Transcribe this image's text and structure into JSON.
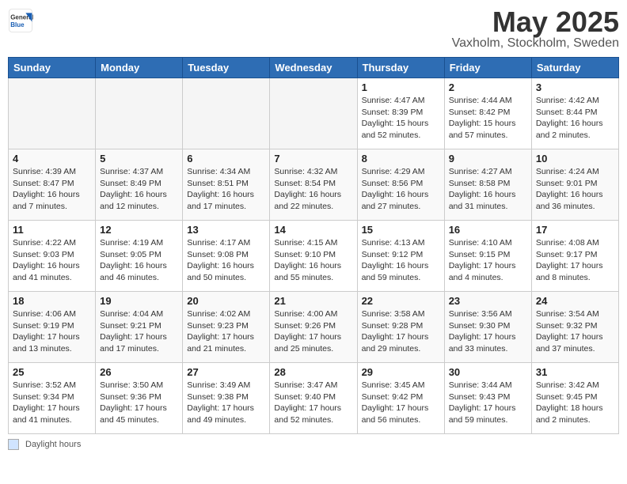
{
  "header": {
    "logo_general": "General",
    "logo_blue": "Blue",
    "month_title": "May 2025",
    "location": "Vaxholm, Stockholm, Sweden"
  },
  "calendar": {
    "days_of_week": [
      "Sunday",
      "Monday",
      "Tuesday",
      "Wednesday",
      "Thursday",
      "Friday",
      "Saturday"
    ],
    "weeks": [
      [
        {
          "day": "",
          "info": ""
        },
        {
          "day": "",
          "info": ""
        },
        {
          "day": "",
          "info": ""
        },
        {
          "day": "",
          "info": ""
        },
        {
          "day": "1",
          "info": "Sunrise: 4:47 AM\nSunset: 8:39 PM\nDaylight: 15 hours\nand 52 minutes."
        },
        {
          "day": "2",
          "info": "Sunrise: 4:44 AM\nSunset: 8:42 PM\nDaylight: 15 hours\nand 57 minutes."
        },
        {
          "day": "3",
          "info": "Sunrise: 4:42 AM\nSunset: 8:44 PM\nDaylight: 16 hours\nand 2 minutes."
        }
      ],
      [
        {
          "day": "4",
          "info": "Sunrise: 4:39 AM\nSunset: 8:47 PM\nDaylight: 16 hours\nand 7 minutes."
        },
        {
          "day": "5",
          "info": "Sunrise: 4:37 AM\nSunset: 8:49 PM\nDaylight: 16 hours\nand 12 minutes."
        },
        {
          "day": "6",
          "info": "Sunrise: 4:34 AM\nSunset: 8:51 PM\nDaylight: 16 hours\nand 17 minutes."
        },
        {
          "day": "7",
          "info": "Sunrise: 4:32 AM\nSunset: 8:54 PM\nDaylight: 16 hours\nand 22 minutes."
        },
        {
          "day": "8",
          "info": "Sunrise: 4:29 AM\nSunset: 8:56 PM\nDaylight: 16 hours\nand 27 minutes."
        },
        {
          "day": "9",
          "info": "Sunrise: 4:27 AM\nSunset: 8:58 PM\nDaylight: 16 hours\nand 31 minutes."
        },
        {
          "day": "10",
          "info": "Sunrise: 4:24 AM\nSunset: 9:01 PM\nDaylight: 16 hours\nand 36 minutes."
        }
      ],
      [
        {
          "day": "11",
          "info": "Sunrise: 4:22 AM\nSunset: 9:03 PM\nDaylight: 16 hours\nand 41 minutes."
        },
        {
          "day": "12",
          "info": "Sunrise: 4:19 AM\nSunset: 9:05 PM\nDaylight: 16 hours\nand 46 minutes."
        },
        {
          "day": "13",
          "info": "Sunrise: 4:17 AM\nSunset: 9:08 PM\nDaylight: 16 hours\nand 50 minutes."
        },
        {
          "day": "14",
          "info": "Sunrise: 4:15 AM\nSunset: 9:10 PM\nDaylight: 16 hours\nand 55 minutes."
        },
        {
          "day": "15",
          "info": "Sunrise: 4:13 AM\nSunset: 9:12 PM\nDaylight: 16 hours\nand 59 minutes."
        },
        {
          "day": "16",
          "info": "Sunrise: 4:10 AM\nSunset: 9:15 PM\nDaylight: 17 hours\nand 4 minutes."
        },
        {
          "day": "17",
          "info": "Sunrise: 4:08 AM\nSunset: 9:17 PM\nDaylight: 17 hours\nand 8 minutes."
        }
      ],
      [
        {
          "day": "18",
          "info": "Sunrise: 4:06 AM\nSunset: 9:19 PM\nDaylight: 17 hours\nand 13 minutes."
        },
        {
          "day": "19",
          "info": "Sunrise: 4:04 AM\nSunset: 9:21 PM\nDaylight: 17 hours\nand 17 minutes."
        },
        {
          "day": "20",
          "info": "Sunrise: 4:02 AM\nSunset: 9:23 PM\nDaylight: 17 hours\nand 21 minutes."
        },
        {
          "day": "21",
          "info": "Sunrise: 4:00 AM\nSunset: 9:26 PM\nDaylight: 17 hours\nand 25 minutes."
        },
        {
          "day": "22",
          "info": "Sunrise: 3:58 AM\nSunset: 9:28 PM\nDaylight: 17 hours\nand 29 minutes."
        },
        {
          "day": "23",
          "info": "Sunrise: 3:56 AM\nSunset: 9:30 PM\nDaylight: 17 hours\nand 33 minutes."
        },
        {
          "day": "24",
          "info": "Sunrise: 3:54 AM\nSunset: 9:32 PM\nDaylight: 17 hours\nand 37 minutes."
        }
      ],
      [
        {
          "day": "25",
          "info": "Sunrise: 3:52 AM\nSunset: 9:34 PM\nDaylight: 17 hours\nand 41 minutes."
        },
        {
          "day": "26",
          "info": "Sunrise: 3:50 AM\nSunset: 9:36 PM\nDaylight: 17 hours\nand 45 minutes."
        },
        {
          "day": "27",
          "info": "Sunrise: 3:49 AM\nSunset: 9:38 PM\nDaylight: 17 hours\nand 49 minutes."
        },
        {
          "day": "28",
          "info": "Sunrise: 3:47 AM\nSunset: 9:40 PM\nDaylight: 17 hours\nand 52 minutes."
        },
        {
          "day": "29",
          "info": "Sunrise: 3:45 AM\nSunset: 9:42 PM\nDaylight: 17 hours\nand 56 minutes."
        },
        {
          "day": "30",
          "info": "Sunrise: 3:44 AM\nSunset: 9:43 PM\nDaylight: 17 hours\nand 59 minutes."
        },
        {
          "day": "31",
          "info": "Sunrise: 3:42 AM\nSunset: 9:45 PM\nDaylight: 18 hours\nand 2 minutes."
        }
      ]
    ]
  },
  "legend": {
    "text": "Daylight hours"
  }
}
